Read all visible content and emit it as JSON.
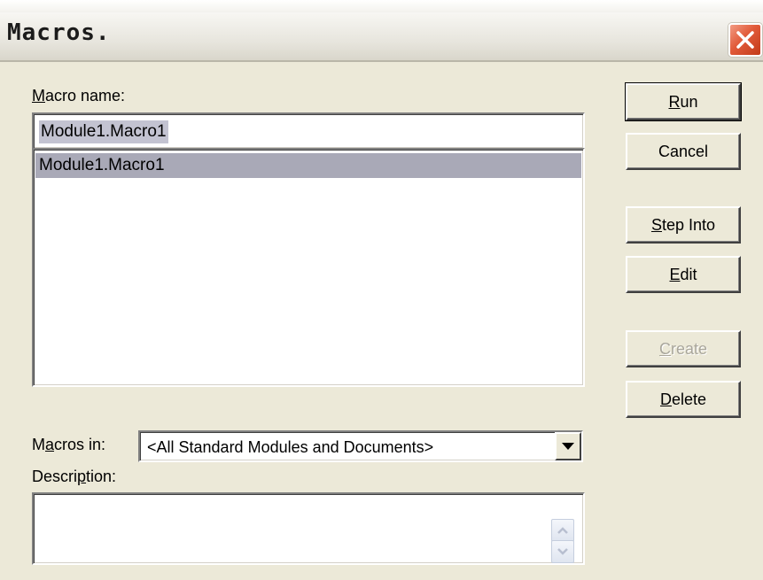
{
  "window": {
    "title": "Macros."
  },
  "macro_name": {
    "label_pre": "",
    "label_accel": "M",
    "label_post": "acro name:",
    "value": "Module1.Macro1"
  },
  "macro_list": {
    "items": [
      "Module1.Macro1"
    ],
    "selected_index": 0
  },
  "buttons": {
    "run": {
      "accel": "R",
      "rest": "un",
      "enabled": true,
      "default": true
    },
    "cancel": {
      "label": "Cancel",
      "enabled": true
    },
    "step_into": {
      "accel": "S",
      "rest": "tep Into",
      "enabled": true
    },
    "edit": {
      "accel": "E",
      "rest": "dit",
      "enabled": true
    },
    "create": {
      "accel": "C",
      "rest": "reate",
      "enabled": false
    },
    "delete": {
      "accel": "D",
      "rest": "elete",
      "enabled": true
    }
  },
  "macros_in": {
    "label_pre": "M",
    "label_accel": "a",
    "label_post": "cros in:",
    "value": "<All Standard Modules and Documents>"
  },
  "description": {
    "label_pre": "Descri",
    "label_accel": "p",
    "label_post": "tion:",
    "value": ""
  },
  "colors": {
    "dialog_bg": "#ece9d8",
    "selection_bg": "#a9a9b7",
    "close_red": "#e15a39",
    "disabled_text": "#a9a69b"
  },
  "icons": {
    "close": "close-x-icon",
    "combo_arrow": "triangle-down-icon",
    "scroll_up": "chevron-up-icon",
    "scroll_down": "chevron-down-icon"
  }
}
